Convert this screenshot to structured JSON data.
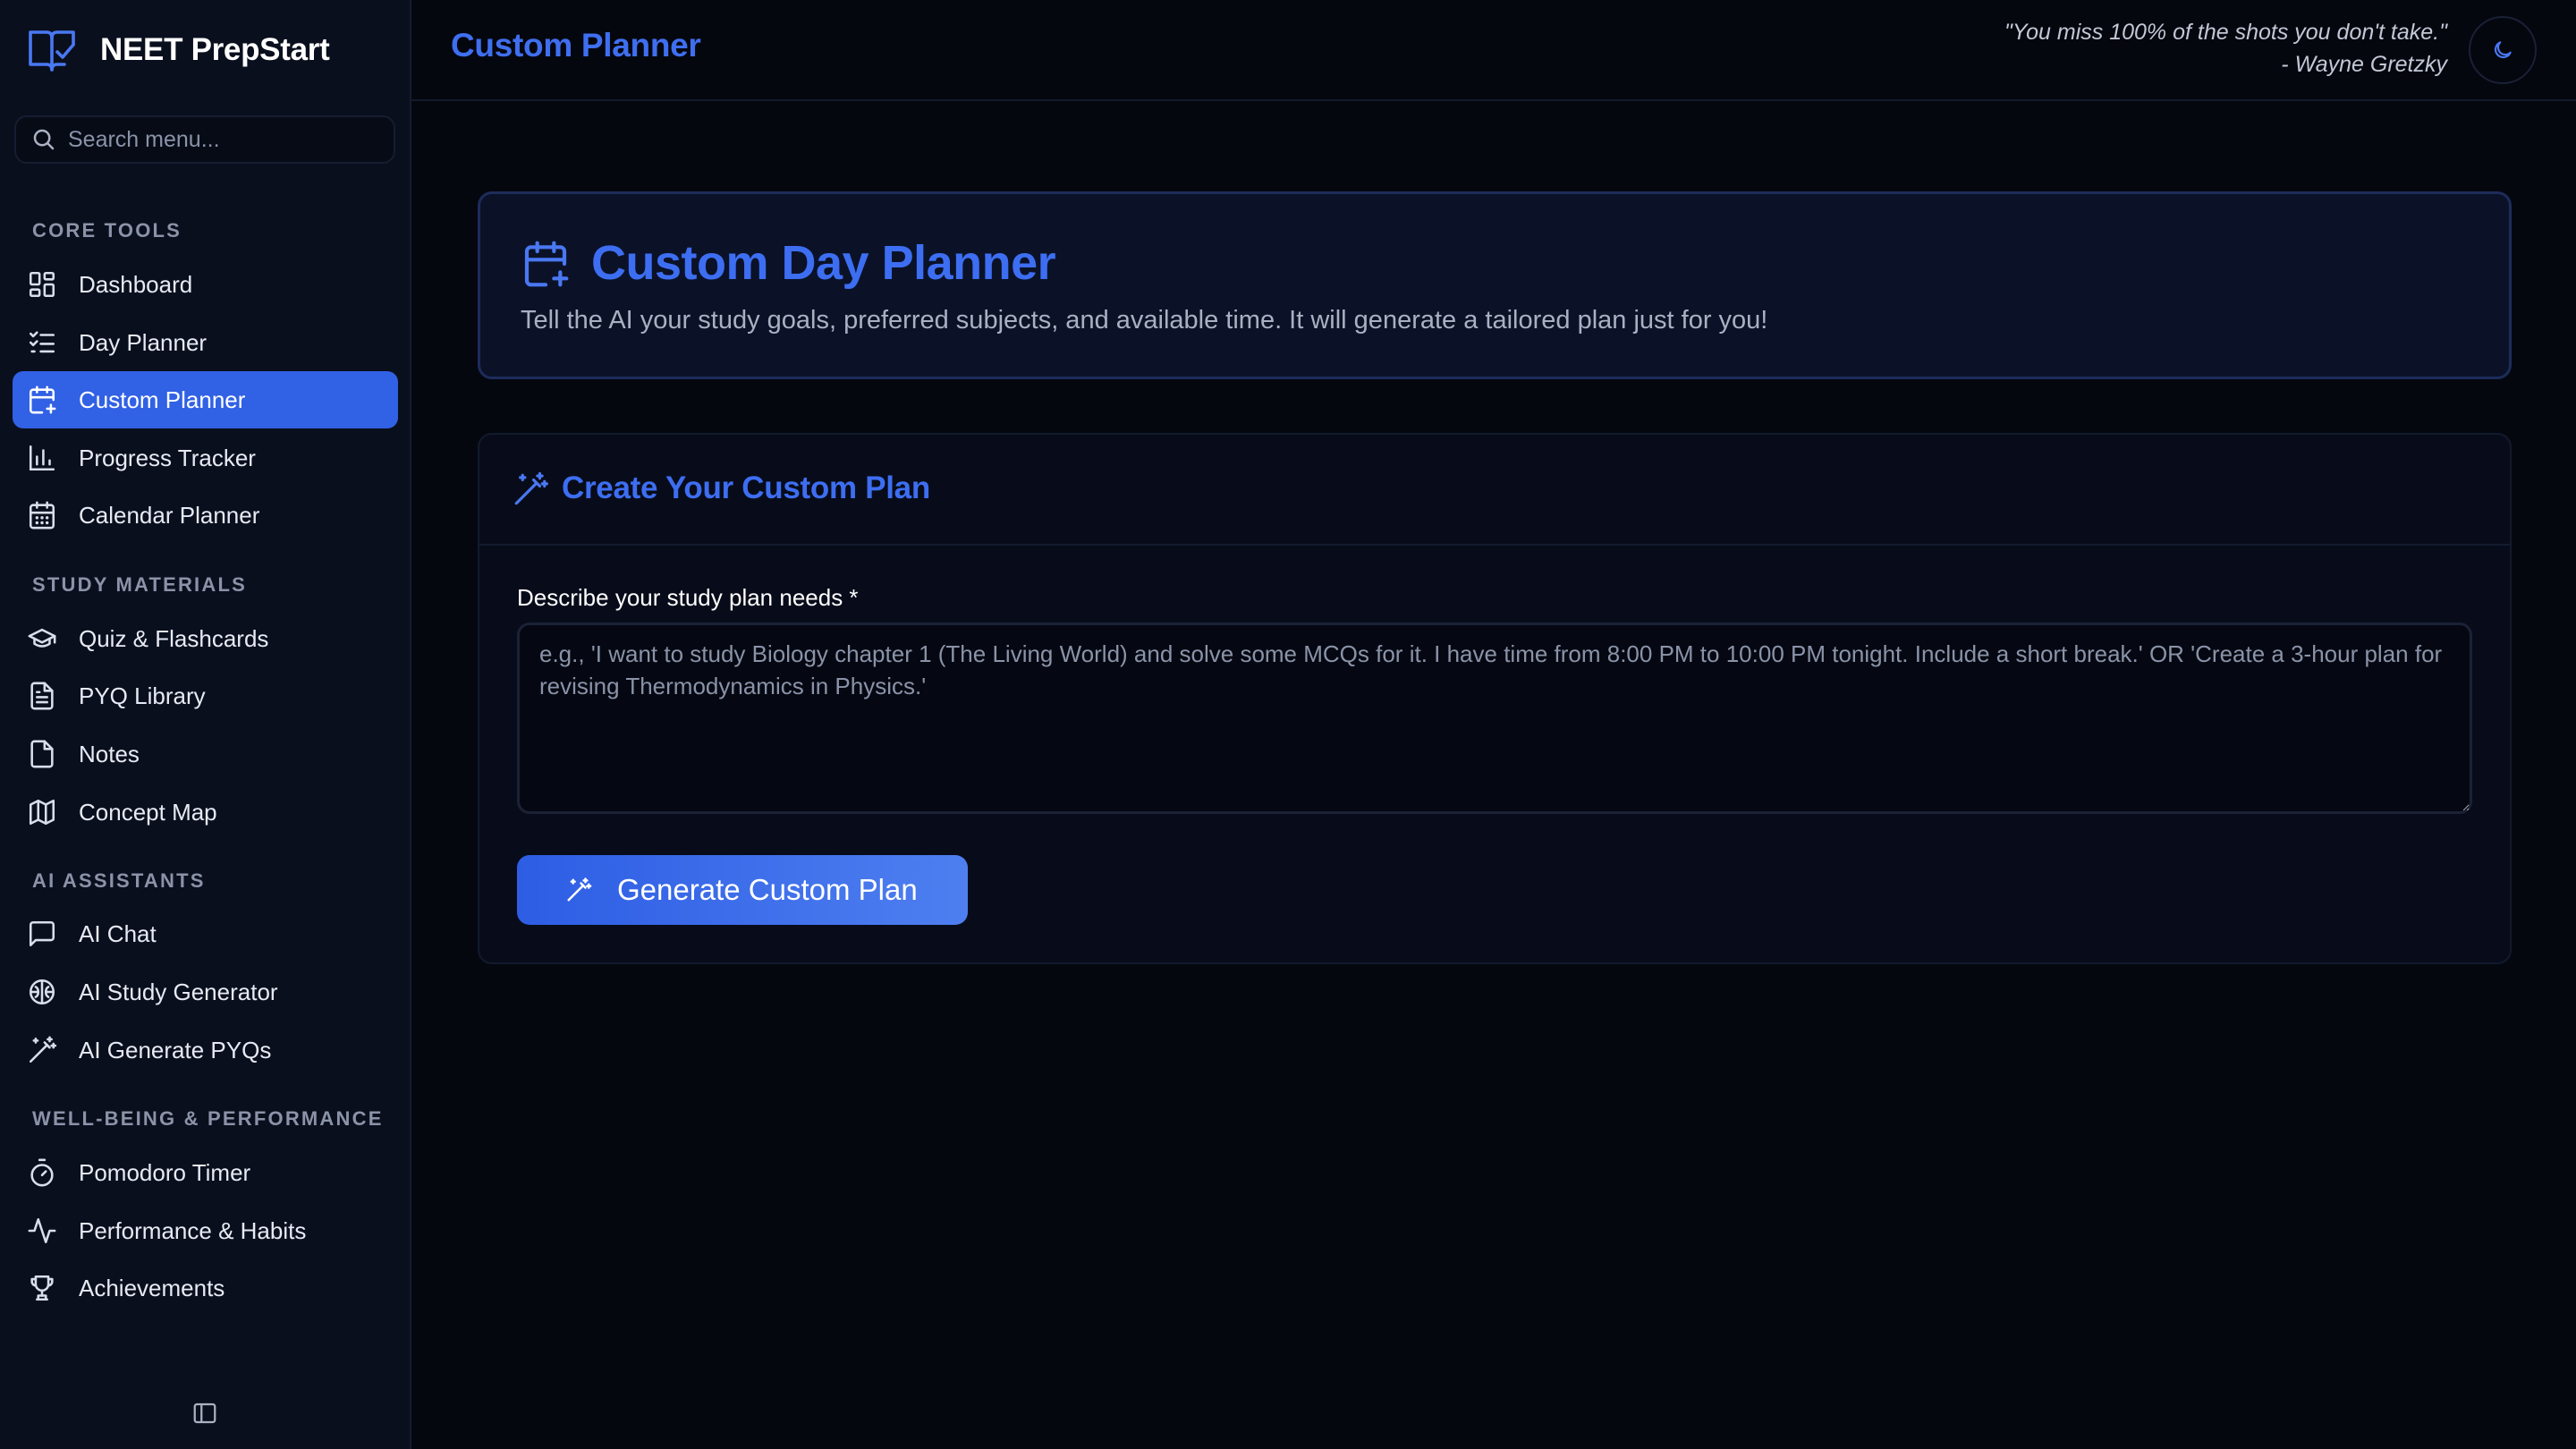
{
  "app": {
    "name": "NEET PrepStart"
  },
  "search": {
    "placeholder": "Search menu..."
  },
  "sidebar": {
    "sections": [
      {
        "label": "CORE TOOLS",
        "items": [
          {
            "label": "Dashboard",
            "icon": "dashboard-icon"
          },
          {
            "label": "Day Planner",
            "icon": "list-checks-icon"
          },
          {
            "label": "Custom Planner",
            "icon": "calendar-plus-icon",
            "active": true
          },
          {
            "label": "Progress Tracker",
            "icon": "bar-chart-icon"
          },
          {
            "label": "Calendar Planner",
            "icon": "calendar-grid-icon"
          }
        ]
      },
      {
        "label": "STUDY MATERIALS",
        "items": [
          {
            "label": "Quiz & Flashcards",
            "icon": "graduation-cap-icon"
          },
          {
            "label": "PYQ Library",
            "icon": "file-text-icon"
          },
          {
            "label": "Notes",
            "icon": "file-icon"
          },
          {
            "label": "Concept Map",
            "icon": "map-icon"
          }
        ]
      },
      {
        "label": "AI ASSISTANTS",
        "items": [
          {
            "label": "AI Chat",
            "icon": "message-square-icon"
          },
          {
            "label": "AI Study Generator",
            "icon": "brain-icon"
          },
          {
            "label": "AI Generate PYQs",
            "icon": "magic-wand-icon"
          }
        ]
      },
      {
        "label": "WELL-BEING & PERFORMANCE",
        "items": [
          {
            "label": "Pomodoro Timer",
            "icon": "timer-icon"
          },
          {
            "label": "Performance & Habits",
            "icon": "activity-icon"
          },
          {
            "label": "Achievements",
            "icon": "trophy-icon"
          }
        ]
      }
    ]
  },
  "header": {
    "title": "Custom Planner",
    "quote": "\"You miss 100% of the shots you don't take.\"",
    "quote_author": "- Wayne Gretzky"
  },
  "hero": {
    "title": "Custom Day Planner",
    "subtitle": "Tell the AI your study goals, preferred subjects, and available time. It will generate a tailored plan just for you!"
  },
  "form": {
    "title": "Create Your Custom Plan",
    "field_label": "Describe your study plan needs *",
    "field_value": "",
    "field_placeholder": "e.g., 'I want to study Biology chapter 1 (The Living World) and solve some MCQs for it. I have time from 8:00 PM to 10:00 PM tonight. Include a short break.' OR 'Create a 3-hour plan for revising Thermodynamics in Physics.'",
    "button_label": "Generate Custom Plan"
  },
  "colors": {
    "accent": "#3d6ef2",
    "active_bg": "#3161e4",
    "background": "#05070f",
    "sidebar_bg": "#0a0f1e"
  }
}
